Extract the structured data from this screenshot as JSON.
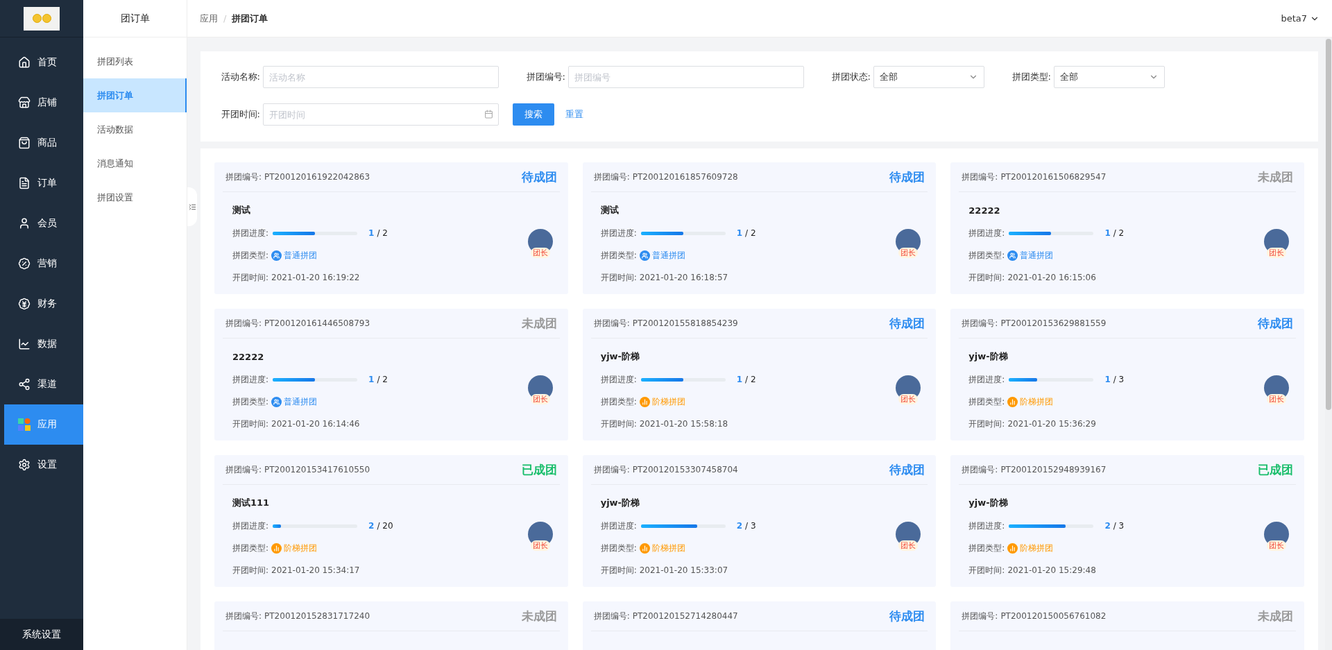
{
  "sidebar": {
    "items": [
      {
        "label": "首页",
        "selected": false
      },
      {
        "label": "店铺",
        "selected": false
      },
      {
        "label": "商品",
        "selected": false
      },
      {
        "label": "订单",
        "selected": false
      },
      {
        "label": "会员",
        "selected": false
      },
      {
        "label": "营销",
        "selected": false
      },
      {
        "label": "财务",
        "selected": false
      },
      {
        "label": "数据",
        "selected": false
      },
      {
        "label": "渠道",
        "selected": false
      },
      {
        "label": "应用",
        "selected": true
      },
      {
        "label": "设置",
        "selected": false
      }
    ],
    "footer": "系统设置"
  },
  "submenu": {
    "title": "团订单",
    "items": [
      {
        "label": "拼团列表",
        "selected": false
      },
      {
        "label": "拼团订单",
        "selected": true
      },
      {
        "label": "活动数据",
        "selected": false
      },
      {
        "label": "消息通知",
        "selected": false
      },
      {
        "label": "拼团设置",
        "selected": false
      }
    ]
  },
  "breadcrumb": {
    "items": [
      "应用",
      "拼团订单"
    ],
    "separator": "/"
  },
  "user": "beta7",
  "filters": {
    "fields": [
      {
        "kind": "input",
        "label": "活动名称:",
        "placeholder": "活动名称"
      },
      {
        "kind": "input",
        "label": "拼团编号:",
        "placeholder": "拼团编号"
      },
      {
        "kind": "select",
        "label": "拼团状态:",
        "value": "全部"
      },
      {
        "kind": "select",
        "label": "拼团类型:",
        "value": "全部"
      },
      {
        "kind": "date",
        "label": "开团时间:",
        "placeholder": "开团时间"
      }
    ],
    "search_button": "搜索",
    "reset_link": "重置"
  },
  "cards": [
    {
      "id_label": "拼团编号:",
      "id": "PT200120161922042863",
      "status": {
        "kind": "pending",
        "text": "待成团"
      },
      "title": "测试",
      "progress_label": "拼团进度:",
      "joined": "1",
      "rest": "/ 2",
      "level": 0.5,
      "type_label": "拼团类型:",
      "type": {
        "kind": "normal",
        "text": "普通拼团"
      },
      "time_label": "开团时间:",
      "time": "2021-01-20 16:19:22",
      "leader": "团长"
    },
    {
      "id_label": "拼团编号:",
      "id": "PT200120161857609728",
      "status": {
        "kind": "pending",
        "text": "待成团"
      },
      "title": "测试",
      "progress_label": "拼团进度:",
      "joined": "1",
      "rest": "/ 2",
      "level": 0.5,
      "type_label": "拼团类型:",
      "type": {
        "kind": "normal",
        "text": "普通拼团"
      },
      "time_label": "开团时间:",
      "time": "2021-01-20 16:18:57",
      "leader": "团长"
    },
    {
      "id_label": "拼团编号:",
      "id": "PT200120161506829547",
      "status": {
        "kind": "failed",
        "text": "未成团"
      },
      "title": "22222",
      "progress_label": "拼团进度:",
      "joined": "1",
      "rest": "/ 2",
      "level": 0.5,
      "type_label": "拼团类型:",
      "type": {
        "kind": "normal",
        "text": "普通拼团"
      },
      "time_label": "开团时间:",
      "time": "2021-01-20 16:15:06",
      "leader": "团长"
    },
    {
      "id_label": "拼团编号:",
      "id": "PT200120161446508793",
      "status": {
        "kind": "failed",
        "text": "未成团"
      },
      "title": "22222",
      "progress_label": "拼团进度:",
      "joined": "1",
      "rest": "/ 2",
      "level": 0.5,
      "type_label": "拼团类型:",
      "type": {
        "kind": "normal",
        "text": "普通拼团"
      },
      "time_label": "开团时间:",
      "time": "2021-01-20 16:14:46",
      "leader": "团长"
    },
    {
      "id_label": "拼团编号:",
      "id": "PT200120155818854239",
      "status": {
        "kind": "pending",
        "text": "待成团"
      },
      "title": "yjw-阶梯",
      "progress_label": "拼团进度:",
      "joined": "1",
      "rest": "/ 2",
      "level": 0.5,
      "type_label": "拼团类型:",
      "type": {
        "kind": "ladder",
        "text": "阶梯拼团"
      },
      "time_label": "开团时间:",
      "time": "2021-01-20 15:58:18",
      "leader": "团长"
    },
    {
      "id_label": "拼团编号:",
      "id": "PT200120153629881559",
      "status": {
        "kind": "pending",
        "text": "待成团"
      },
      "title": "yjw-阶梯",
      "progress_label": "拼团进度:",
      "joined": "1",
      "rest": "/ 3",
      "level": 0.33,
      "type_label": "拼团类型:",
      "type": {
        "kind": "ladder",
        "text": "阶梯拼团"
      },
      "time_label": "开团时间:",
      "time": "2021-01-20 15:36:29",
      "leader": "团长"
    },
    {
      "id_label": "拼团编号:",
      "id": "PT200120153417610550",
      "status": {
        "kind": "success",
        "text": "已成团"
      },
      "title": "测试111",
      "progress_label": "拼团进度:",
      "joined": "2",
      "rest": "/ 20",
      "level": 0.1,
      "type_label": "拼团类型:",
      "type": {
        "kind": "ladder",
        "text": "阶梯拼团"
      },
      "time_label": "开团时间:",
      "time": "2021-01-20 15:34:17",
      "leader": "团长"
    },
    {
      "id_label": "拼团编号:",
      "id": "PT200120153307458704",
      "status": {
        "kind": "pending",
        "text": "待成团"
      },
      "title": "yjw-阶梯",
      "progress_label": "拼团进度:",
      "joined": "2",
      "rest": "/ 3",
      "level": 0.67,
      "type_label": "拼团类型:",
      "type": {
        "kind": "ladder",
        "text": "阶梯拼团"
      },
      "time_label": "开团时间:",
      "time": "2021-01-20 15:33:07",
      "leader": "团长"
    },
    {
      "id_label": "拼团编号:",
      "id": "PT200120152948939167",
      "status": {
        "kind": "success",
        "text": "已成团"
      },
      "title": "yjw-阶梯",
      "progress_label": "拼团进度:",
      "joined": "2",
      "rest": "/ 3",
      "level": 0.67,
      "type_label": "拼团类型:",
      "type": {
        "kind": "ladder",
        "text": "阶梯拼团"
      },
      "time_label": "开团时间:",
      "time": "2021-01-20 15:29:48",
      "leader": "团长"
    },
    {
      "id_label": "拼团编号:",
      "id": "PT200120152831717240",
      "status": {
        "kind": "failed",
        "text": "未成团"
      }
    },
    {
      "id_label": "拼团编号:",
      "id": "PT200120152714280447",
      "status": {
        "kind": "pending",
        "text": "待成团"
      }
    },
    {
      "id_label": "拼团编号:",
      "id": "PT200120150056761082",
      "status": {
        "kind": "failed",
        "text": "未成团"
      }
    }
  ]
}
